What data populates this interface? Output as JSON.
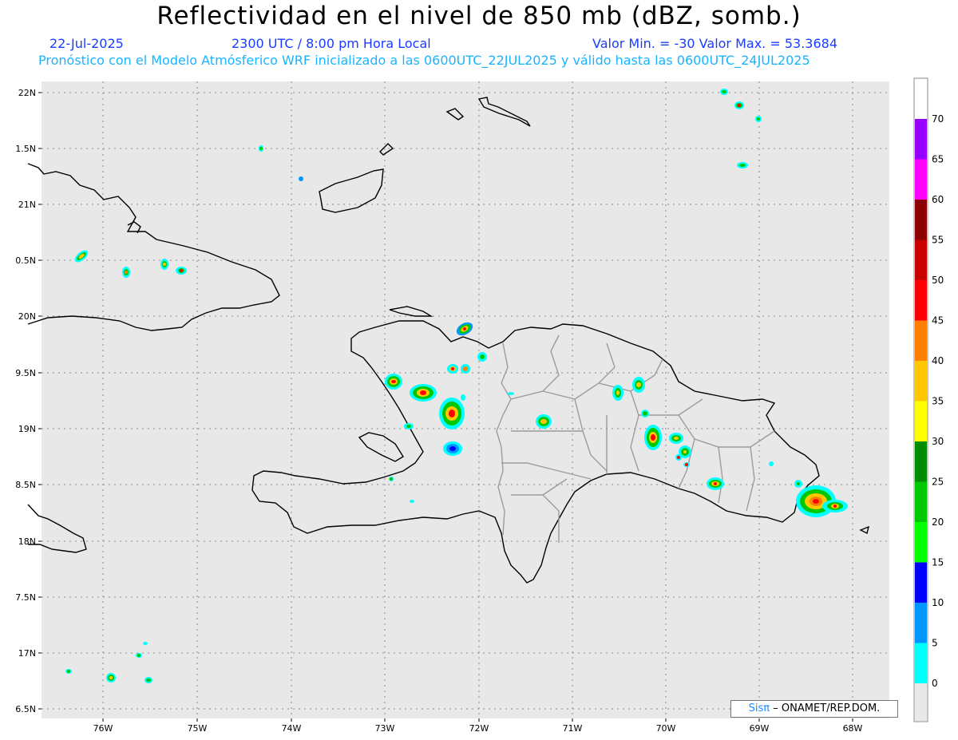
{
  "header": {
    "title": "Reflectividad en el nivel de 850 mb (dBZ, somb.)",
    "date": "22-Jul-2025",
    "time": "2300 UTC / 8:00 pm Hora Local",
    "minmax": "Valor Min. = -30  Valor Max. = 53.3684",
    "forecast": "Pronóstico con el Modelo Atmósferico WRF inicializado a las 0600UTC_22JUL2025 y válido hasta las  0600UTC_24JUL2025"
  },
  "map": {
    "lat_labels": [
      "22N",
      "1.5N",
      "21N",
      "0.5N",
      "20N",
      "9.5N",
      "19N",
      "8.5N",
      "18N",
      "7.5N",
      "17N",
      "6.5N"
    ],
    "lon_labels": [
      "76W",
      "75W",
      "74W",
      "73W",
      "72W",
      "71W",
      "70W",
      "69W",
      "68W"
    ],
    "background": "#e8e8e8"
  },
  "colorbar": {
    "labels": [
      "70",
      "65",
      "60",
      "55",
      "50",
      "45",
      "40",
      "35",
      "30",
      "25",
      "20",
      "15",
      "10",
      "5",
      "0"
    ],
    "colors": [
      "#9600ff",
      "#ff00ff",
      "#8b0000",
      "#c80000",
      "#ff0000",
      "#ff7f00",
      "#ffc800",
      "#ffff00",
      "#008c00",
      "#00c800",
      "#00ff00",
      "#0000ff",
      "#0096ff",
      "#00ffff",
      "#e8e8e8"
    ]
  },
  "credit": {
    "logo": "Sisπ",
    "text": "– ONAMET/REP.DOM."
  }
}
